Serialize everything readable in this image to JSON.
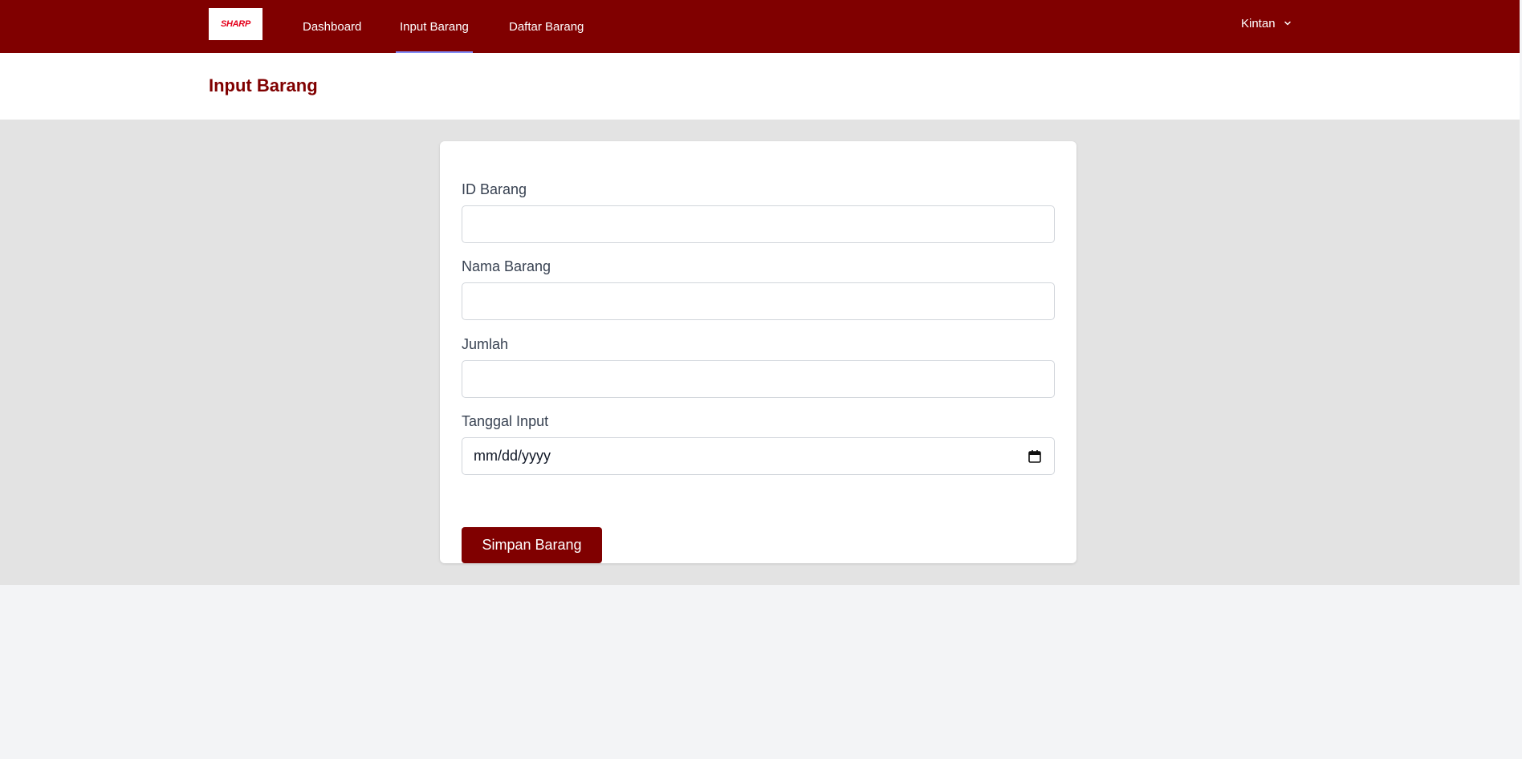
{
  "brand": {
    "logo_text": "SHARP",
    "accent": "#800000"
  },
  "nav": {
    "items": [
      {
        "label": "Dashboard"
      },
      {
        "label": "Input Barang"
      },
      {
        "label": "Daftar Barang"
      }
    ],
    "active": "Input Barang"
  },
  "user": {
    "name": "Kintan"
  },
  "header": {
    "title": "Input Barang"
  },
  "form": {
    "fields": [
      {
        "label": "ID Barang",
        "value": ""
      },
      {
        "label": "Nama Barang",
        "value": ""
      },
      {
        "label": "Jumlah",
        "value": ""
      },
      {
        "label": "Tanggal Input",
        "placeholder": "mm/dd/yyyy"
      }
    ],
    "submit_label": "Simpan Barang"
  }
}
